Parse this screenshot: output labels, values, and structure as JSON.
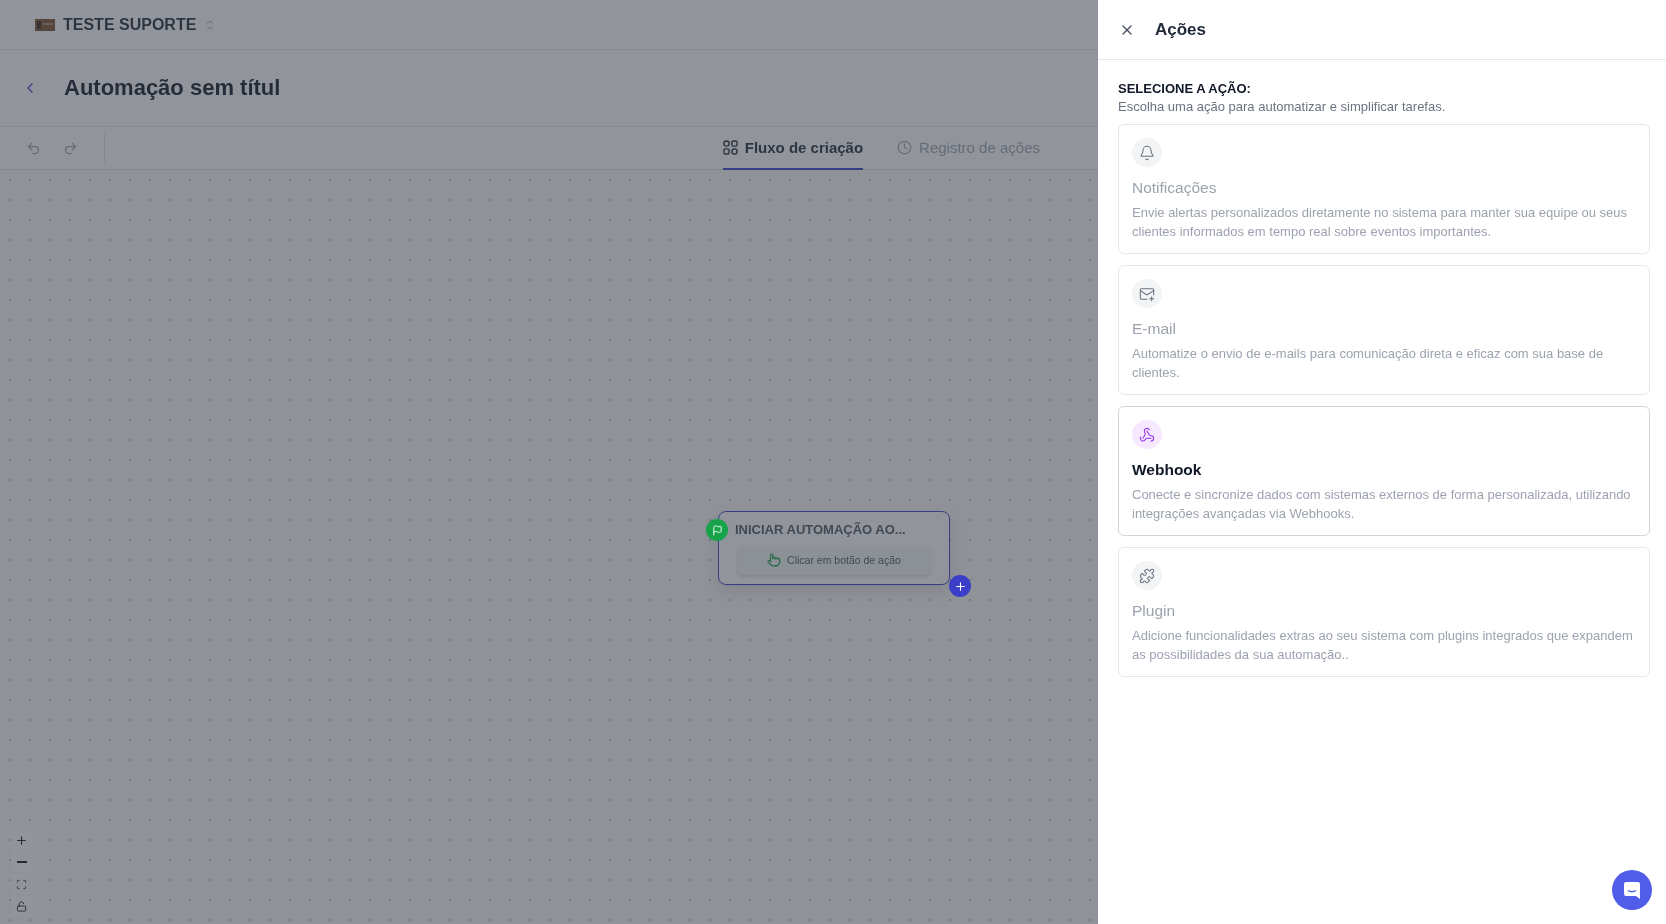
{
  "workspace": {
    "name": "TESTE SUPORTE"
  },
  "page_title": "Automação sem títul",
  "tabs": [
    {
      "label": "Fluxo de criação",
      "selected": true,
      "kind": "flow"
    },
    {
      "label": "Registro de ações",
      "selected": false,
      "kind": "history"
    }
  ],
  "node": {
    "title": "INICIAR AUTOMAÇÃO AO...",
    "trigger": "Clicar em botão de ação"
  },
  "panel": {
    "title": "Ações",
    "heading": "SELECIONE A AÇÃO:",
    "subtitle": "Escolha uma ação para automatizar e simplificar tarefas.",
    "actions": [
      {
        "kind": "bell",
        "title": "Notificações",
        "description": "Envie alertas personalizados diretamente no sistema para manter sua equipe ou seus clientes informados em tempo real sobre eventos importantes.",
        "disabled": true
      },
      {
        "kind": "mail",
        "title": "E-mail",
        "description": "Automatize o envio de e-mails para comunicação direta e eficaz com sua base de clientes.",
        "disabled": true
      },
      {
        "kind": "webhook",
        "title": "Webhook",
        "description": "Conecte e sincronize dados com sistemas externos de forma personalizada, utilizando integrações avançadas via Webhooks.",
        "disabled": false
      },
      {
        "kind": "plugin",
        "title": "Plugin",
        "description": "Adicione funcionalidades extras ao seu sistema com plugins integrados que expandem as possibilidades da sua automação..",
        "disabled": true
      }
    ]
  }
}
